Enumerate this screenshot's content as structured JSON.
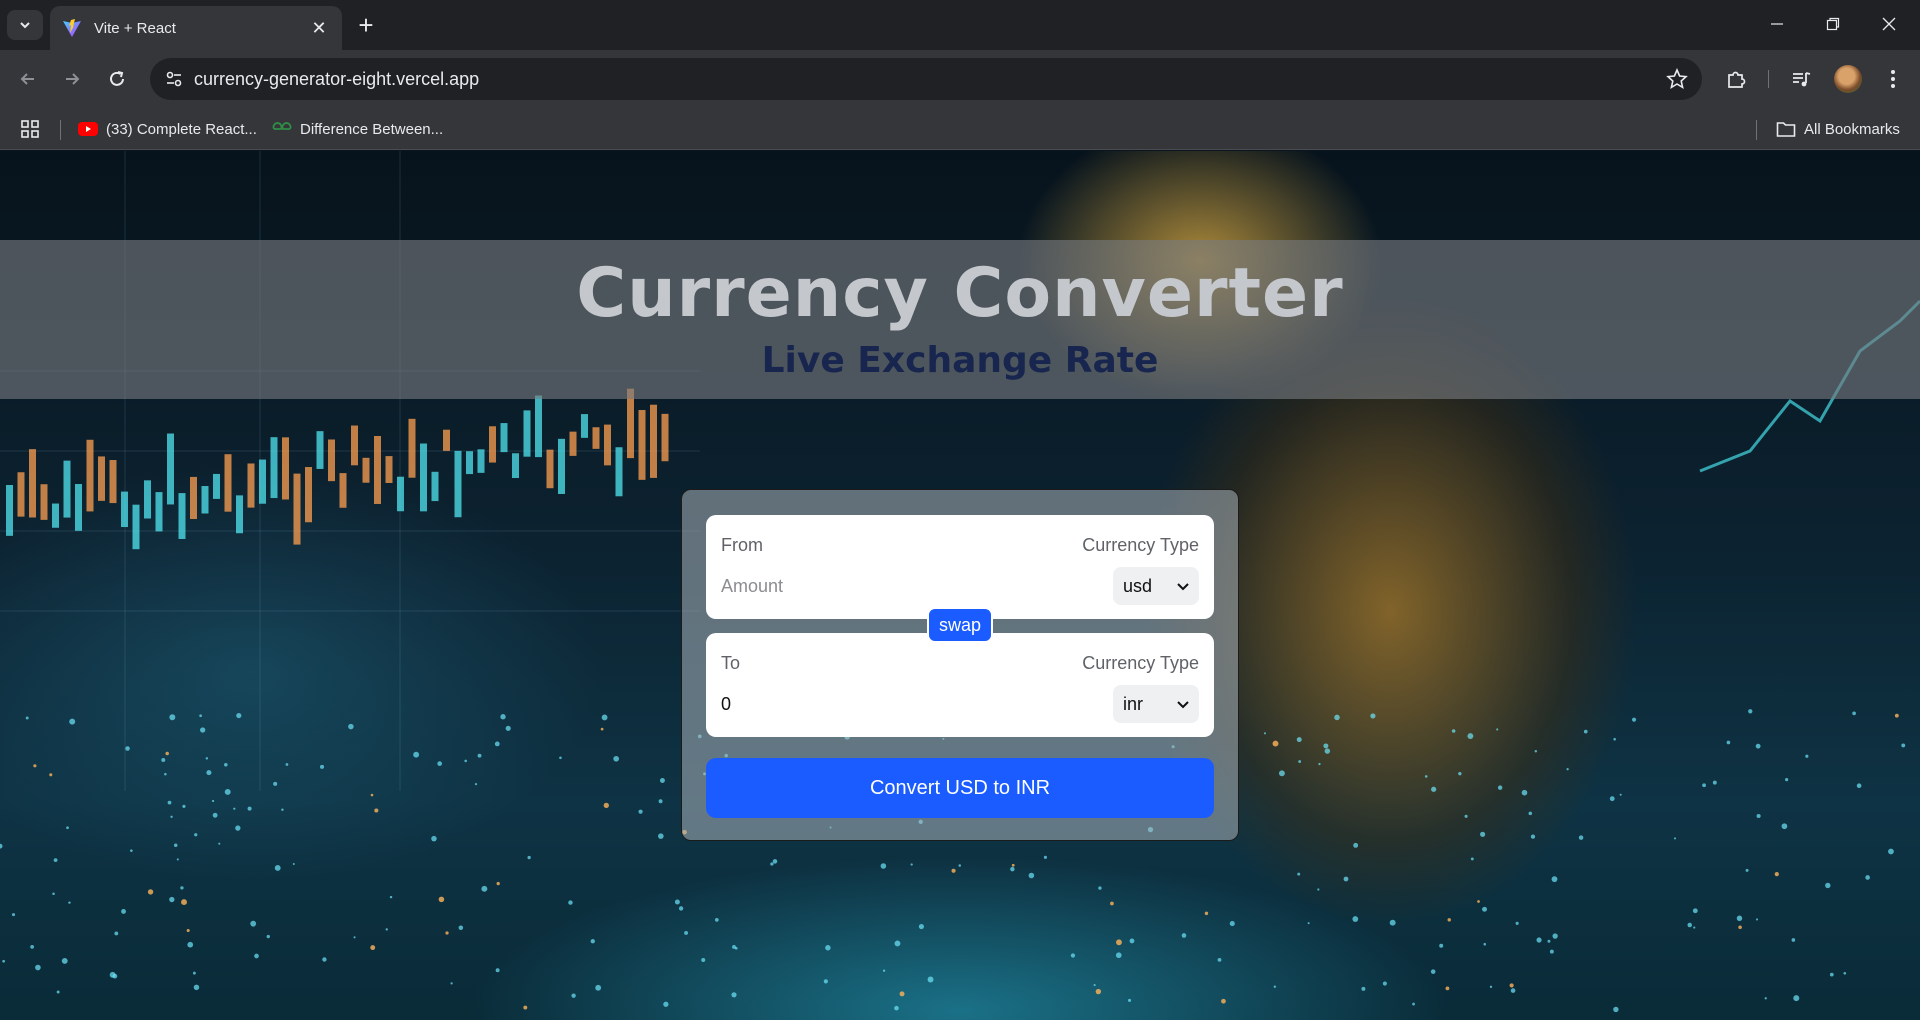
{
  "browser": {
    "tab_title": "Vite + React",
    "url": "currency-generator-eight.vercel.app",
    "bookmarks": [
      {
        "label": "(33) Complete React..."
      },
      {
        "label": "Difference Between..."
      }
    ],
    "all_bookmarks_label": "All Bookmarks"
  },
  "hero": {
    "title": "Currency Converter",
    "subtitle": "Live Exchange Rate"
  },
  "converter": {
    "from": {
      "label": "From",
      "type_label": "Currency Type",
      "amount_value": "",
      "amount_placeholder": "Amount",
      "currency": "usd"
    },
    "swap_label": "swap",
    "to": {
      "label": "To",
      "type_label": "Currency Type",
      "amount_value": "0",
      "currency": "inr"
    },
    "convert_label": "Convert USD to INR"
  },
  "colors": {
    "accent": "#1a5cff",
    "title": "#c4c7cc",
    "subtitle": "#17254f",
    "chrome_bg": "#202124",
    "toolbar_bg": "#35363a"
  }
}
